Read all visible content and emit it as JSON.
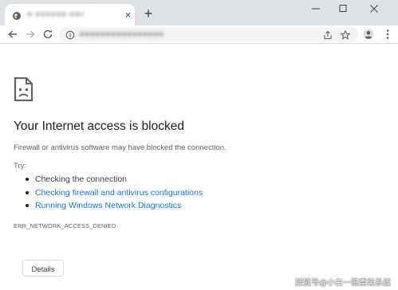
{
  "browser": {
    "tab": {
      "title": "● ●●●●●● ●●●",
      "close_glyph": "×"
    },
    "new_tab_glyph": "+",
    "window_controls": [
      "minimize-icon",
      "maximize-icon",
      "close-icon"
    ],
    "toolbar": {
      "icons": [
        "back-arrow-icon",
        "forward-arrow-icon",
        "reload-icon"
      ],
      "address_bar": {
        "url": "●●●●●●●●●●●●●●●●",
        "icons": [
          "info-icon",
          "share-icon",
          "bookmark-star-icon",
          "profile-icon",
          "menu-dots-icon"
        ]
      }
    },
    "colors": {
      "tabstrip_bg": "#dee1e6",
      "link": "#1a73e8",
      "title_text": "#202124",
      "secondary_text": "#5f6368"
    }
  },
  "error_page": {
    "icon": "sad-page-icon",
    "title": "Your Internet access is blocked",
    "description": "Firewall or antivirus software may have blocked the connection.",
    "try_label": "Try:",
    "suggestions": [
      {
        "text": "Checking the connection",
        "is_link": false
      },
      {
        "text": "Checking firewall and antivirus configurations",
        "is_link": true
      },
      {
        "text": "Running Windows Network Diagnostics",
        "is_link": true
      }
    ],
    "error_code": "ERR_NETWORK_ACCESS_DENIED",
    "details_button": "Details"
  },
  "watermark": "搜狐号@小白一键重装系统"
}
